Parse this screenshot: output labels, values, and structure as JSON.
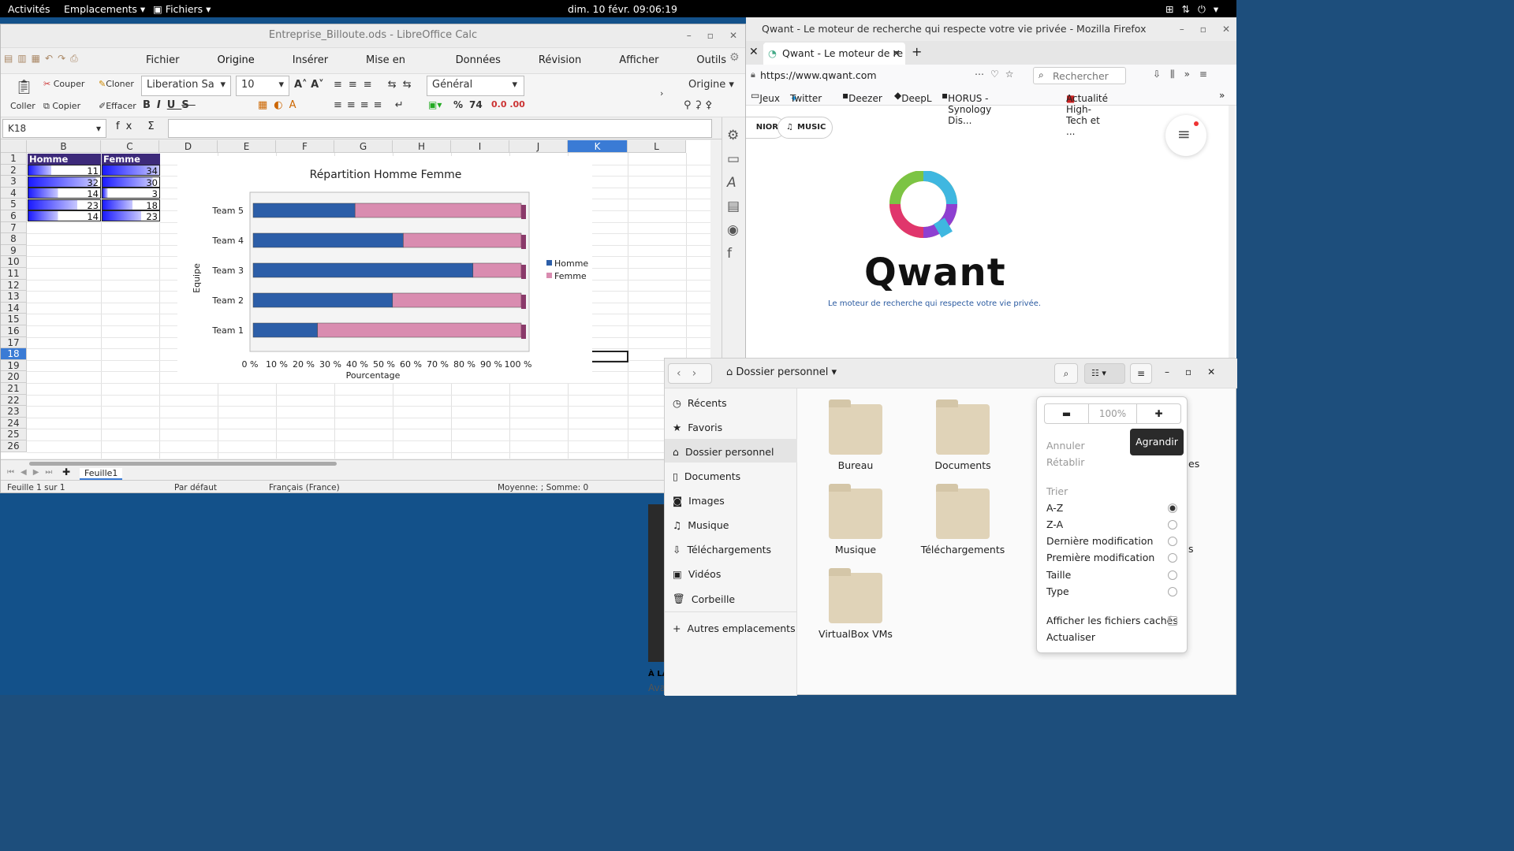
{
  "topbar": {
    "activities": "Activités",
    "places": "Emplacements",
    "files_menu": "Fichiers",
    "clock": "dim. 10 févr.  09:06:19"
  },
  "calc": {
    "title": "Entreprise_Billoute.ods - LibreOffice Calc",
    "menus": [
      "Fichier",
      "Origine",
      "Insérer",
      "Mise en page",
      "Données",
      "Révision",
      "Afficher",
      "Outils"
    ],
    "toolbar": {
      "paste": "Coller",
      "cut": "Couper",
      "copy": "Copier",
      "clone": "Cloner",
      "clear": "Effacer",
      "font": "Liberation Sa",
      "size": "10",
      "format": "Général",
      "style": "Origine",
      "percent": "%",
      "num": "74"
    },
    "cellref": "K18",
    "columns": [
      "B",
      "C",
      "D",
      "E",
      "F",
      "G",
      "H",
      "I",
      "J",
      "K",
      "L"
    ],
    "rows": [
      "1",
      "2",
      "3",
      "4",
      "5",
      "6",
      "7",
      "8",
      "9",
      "10",
      "11",
      "12",
      "13",
      "14",
      "15",
      "16",
      "17",
      "18",
      "19",
      "20",
      "21",
      "22",
      "23",
      "24",
      "25",
      "26"
    ],
    "table": {
      "h1": "Homme",
      "h2": "Femme",
      "homme": [
        "11",
        "32",
        "14",
        "23",
        "14"
      ],
      "femme": [
        "34",
        "30",
        "3",
        "18",
        "23"
      ]
    },
    "sheet_tab": "Feuille1",
    "status": {
      "sheet": "Feuille 1 sur 1",
      "style": "Par défaut",
      "lang": "Français (France)",
      "sum": "Moyenne: ; Somme: 0"
    }
  },
  "chart_data": {
    "type": "bar",
    "title": "Répartition Homme Femme",
    "xlabel": "Pourcentage",
    "ylabel": "Equipe",
    "categories": [
      "Team 1",
      "Team 2",
      "Team 3",
      "Team 4",
      "Team 5"
    ],
    "series": [
      {
        "name": "Homme",
        "values": [
          24,
          52,
          82,
          56,
          38
        ],
        "color": "#2c5ea8"
      },
      {
        "name": "Femme",
        "values": [
          76,
          48,
          18,
          44,
          62
        ],
        "color": "#d98cb0"
      }
    ],
    "xticks": [
      "0 %",
      "10 %",
      "20 %",
      "30 %",
      "40 %",
      "50 %",
      "60 %",
      "70 %",
      "80 %",
      "90 %",
      "100 %"
    ],
    "xlim": [
      0,
      100
    ],
    "stacked": "percent",
    "legend": "right"
  },
  "firefox": {
    "title": "Qwant - Le moteur de recherche qui respecte votre vie privée - Mozilla Firefox",
    "tab": "Qwant - Le moteur de re",
    "url": "https://www.qwant.com",
    "search_placeholder": "Rechercher",
    "bookmarks": [
      "Jeux",
      "Twitter",
      "Deezer",
      "DeepL",
      "HORUS - Synology Dis...",
      "Actualité High-Tech et ..."
    ],
    "pills": [
      "NIOR",
      "MUSIC"
    ],
    "logo": "Qwant",
    "tagline": "Le moteur de recherche qui respecte votre vie privée."
  },
  "files": {
    "location": "Dossier personnel",
    "sidebar": [
      "Récents",
      "Favoris",
      "Dossier personnel",
      "Documents",
      "Images",
      "Musique",
      "Téléchargements",
      "Vidéos",
      "Corbeille",
      "Autres emplacements"
    ],
    "folders": [
      "Bureau",
      "Documents",
      "Musique",
      "Téléchargements",
      "VirtualBox VMs"
    ],
    "popover": {
      "zoom": "100%",
      "undo": "Annuler",
      "redo": "Rétablir",
      "sort": "Trier",
      "az": "A-Z",
      "za": "Z-A",
      "last": "Dernière modification",
      "first": "Première modification",
      "size": "Taille",
      "type": "Type",
      "hidden": "Afficher les fichiers cachés",
      "refresh": "Actualiser"
    },
    "tooltip": "Agrandir",
    "partial": [
      "es",
      "s"
    ]
  },
  "bg": {
    "partial": [
      "À LA",
      "Ava"
    ]
  }
}
